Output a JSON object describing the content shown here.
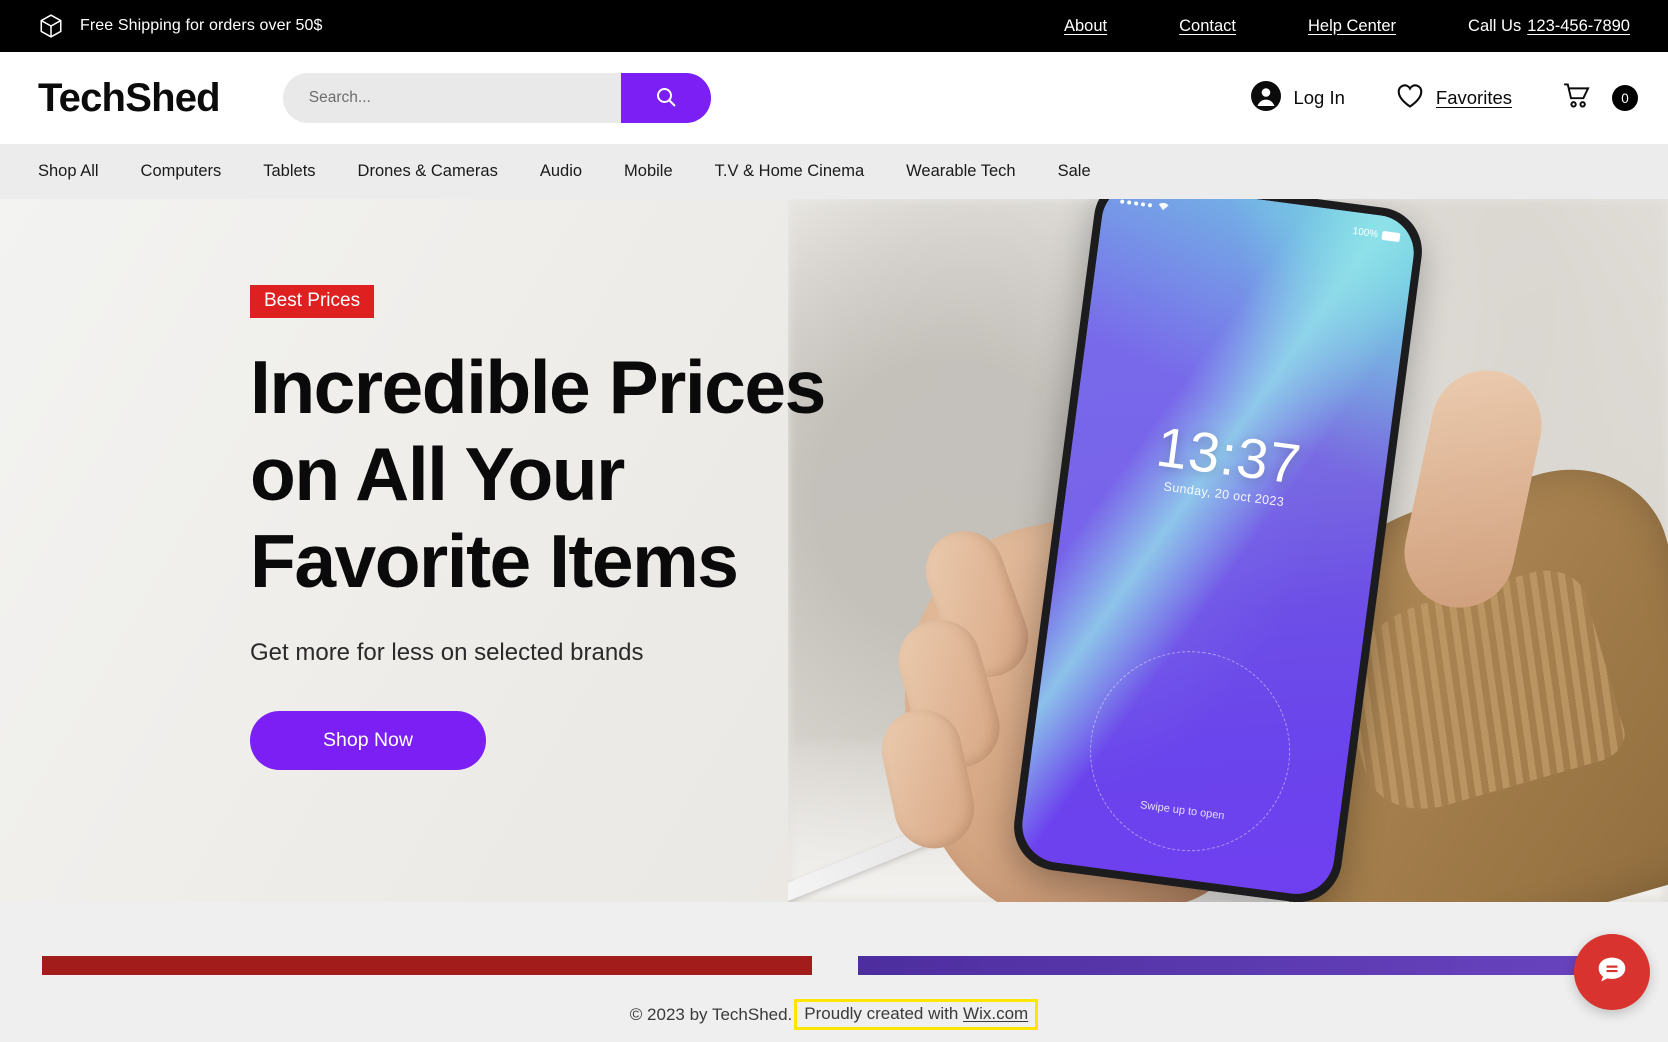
{
  "promo": {
    "icon": "package-icon",
    "text": "Free Shipping for orders over 50$",
    "links": [
      {
        "label": "About"
      },
      {
        "label": "Contact"
      },
      {
        "label": "Help Center"
      }
    ],
    "call_us_label": "Call Us",
    "phone": "123-456-7890"
  },
  "header": {
    "logo": "TechShed",
    "search": {
      "placeholder": "Search...",
      "value": "",
      "icon": "search-icon"
    },
    "login_label": "Log In",
    "favorites_label": "Favorites",
    "cart_count": "0"
  },
  "nav": {
    "items": [
      {
        "label": "Shop All"
      },
      {
        "label": "Computers"
      },
      {
        "label": "Tablets"
      },
      {
        "label": "Drones & Cameras"
      },
      {
        "label": "Audio"
      },
      {
        "label": "Mobile"
      },
      {
        "label": "T.V & Home Cinema"
      },
      {
        "label": "Wearable Tech"
      },
      {
        "label": "Sale"
      }
    ]
  },
  "hero": {
    "badge": "Best Prices",
    "title": "Incredible Prices on All Your Favorite Items",
    "subtitle": "Get more for less on selected brands",
    "cta_label": "Shop Now",
    "phone_screen": {
      "battery": "100%",
      "time": "13:37",
      "date": "Sunday, 20 oct 2023",
      "swipe_hint": "Swipe up to open"
    }
  },
  "footer": {
    "copyright": "© 2023 by TechShed.",
    "created_prefix": "Proudly created with",
    "created_link": "Wix.com",
    "chat_icon": "chat-bubble-icon"
  },
  "colors": {
    "accent_purple": "#7B1FF5",
    "badge_red": "#DF2020",
    "bar_red": "#A31C1C",
    "bar_purple": "#5B3AA8",
    "chat_red": "#D8332F",
    "highlight_yellow": "#FFE600"
  }
}
